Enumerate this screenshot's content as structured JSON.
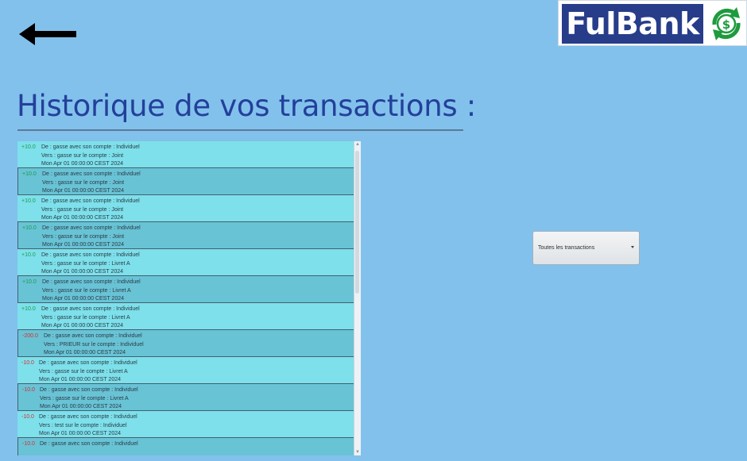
{
  "logo": {
    "text": "FulBank",
    "icon": "dollar-recycle-icon",
    "brand_color": "#273d8a",
    "accent_color": "#1e9b3d"
  },
  "back": {
    "icon": "arrow-left-icon"
  },
  "page": {
    "title": "Historique de vos transactions :"
  },
  "filter": {
    "selected": "Toutes les transactions",
    "icon": "chevron-down-icon"
  },
  "transactions": [
    {
      "amount": "+10.0",
      "sign": "pos",
      "from": "De : gasse avec son compte : Individuel",
      "to": "Vers : gasse sur le compte : Joint",
      "date": "Mon Apr 01 00:00:00 CEST 2024"
    },
    {
      "amount": "+10.0",
      "sign": "pos",
      "from": "De : gasse avec son compte : Individuel",
      "to": "Vers : gasse sur le compte : Joint",
      "date": "Mon Apr 01 00:00:00 CEST 2024"
    },
    {
      "amount": "+10.0",
      "sign": "pos",
      "from": "De : gasse avec son compte : Individuel",
      "to": "Vers : gasse sur le compte : Joint",
      "date": "Mon Apr 01 00:00:00 CEST 2024"
    },
    {
      "amount": "+10.0",
      "sign": "pos",
      "from": "De : gasse avec son compte : Individuel",
      "to": "Vers : gasse sur le compte : Joint",
      "date": "Mon Apr 01 00:00:00 CEST 2024"
    },
    {
      "amount": "+10.0",
      "sign": "pos",
      "from": "De : gasse avec son compte : Individuel",
      "to": "Vers : gasse sur le compte : Livret A",
      "date": "Mon Apr 01 00:00:00 CEST 2024"
    },
    {
      "amount": "+10.0",
      "sign": "pos",
      "from": "De : gasse avec son compte : Individuel",
      "to": "Vers : gasse sur le compte : Livret A",
      "date": "Mon Apr 01 00:00:00 CEST 2024"
    },
    {
      "amount": "+10.0",
      "sign": "pos",
      "from": "De : gasse avec son compte : Individuel",
      "to": "Vers : gasse sur le compte : Livret A",
      "date": "Mon Apr 01 00:00:00 CEST 2024"
    },
    {
      "amount": "-200.0",
      "sign": "neg",
      "from": "De : gasse avec son compte : Individuel",
      "to": "Vers : PRIEUR sur le compte : Individuel",
      "date": "Mon Apr 01 00:00:00 CEST 2024"
    },
    {
      "amount": "-10.0",
      "sign": "neg",
      "from": "De : gasse avec son compte : Individuel",
      "to": "Vers : gasse sur le compte : Livret A",
      "date": "Mon Apr 01 00:00:00 CEST 2024"
    },
    {
      "amount": "-10.0",
      "sign": "neg",
      "from": "De : gasse avec son compte : Individuel",
      "to": "Vers : gasse sur le compte : Livret A",
      "date": "Mon Apr 01 00:00:00 CEST 2024"
    },
    {
      "amount": "-10.0",
      "sign": "neg",
      "from": "De : gasse avec son compte : Individuel",
      "to": "Vers : test sur le compte : Individuel",
      "date": "Mon Apr 01 00:00:00 CEST 2024"
    },
    {
      "amount": "-10.0",
      "sign": "neg",
      "from": "De : gasse avec son compte : Individuel",
      "to": "",
      "date": ""
    }
  ]
}
